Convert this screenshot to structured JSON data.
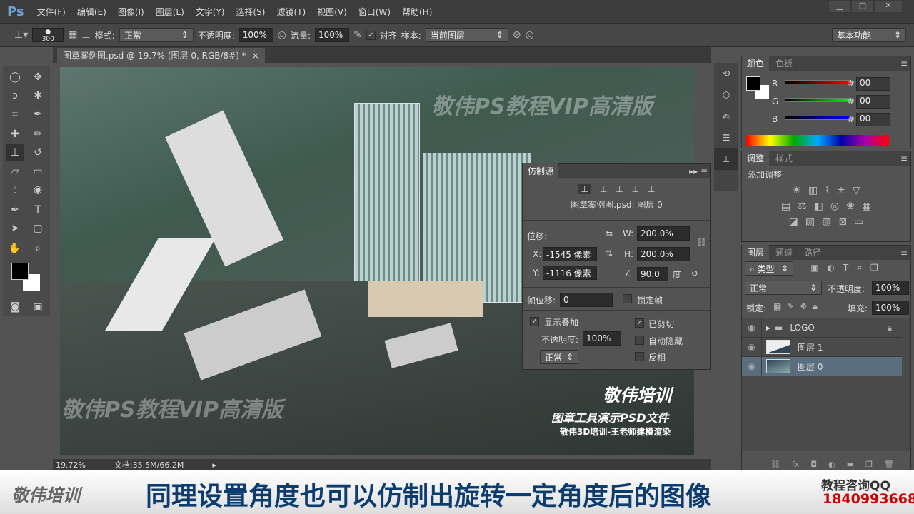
{
  "app": {
    "logo": "Ps",
    "menu": [
      "文件(F)",
      "编辑(E)",
      "图像(I)",
      "图层(L)",
      "文字(Y)",
      "选择(S)",
      "滤镜(T)",
      "视图(V)",
      "窗口(W)",
      "帮助(H)"
    ]
  },
  "options": {
    "brush_size": "300",
    "mode_label": "模式:",
    "mode": "正常",
    "opacity_label": "不透明度:",
    "opacity": "100%",
    "flow_label": "流量:",
    "flow": "100%",
    "align_label": "对齐",
    "sample_label": "样本:",
    "sample": "当前图层",
    "workspace": "基本功能"
  },
  "document": {
    "tab": "图章案例图.psd @ 19.7% (图层 0, RGB/8#) *",
    "zoom": "19.72%",
    "doc_size": "文档:35.5M/66.2M"
  },
  "canvas_text": {
    "watermark": "敬伟PS教程VIP高清版",
    "brand": "敬伟培训",
    "line1": "图章工具演示PSD文件",
    "line2": "敬伟3D培训-王老师建模渲染"
  },
  "clone_source": {
    "title": "仿制源",
    "source": "图章案例图.psd: 图层 0",
    "offset_label": "位移:",
    "x_label": "X:",
    "x": "-1545 像素",
    "y_label": "Y:",
    "y": "-1116 像素",
    "w_label": "W:",
    "w": "200.0%",
    "h_label": "H:",
    "h": "200.0%",
    "angle": "90.0",
    "angle_unit": "度",
    "frame_offset_label": "帧位移:",
    "frame_offset": "0",
    "lock_frame": "锁定帧",
    "show_overlay": "显示叠加",
    "overlay_opacity_label": "不透明度:",
    "overlay_opacity": "100%",
    "clipped": "已剪切",
    "auto_hide": "自动隐藏",
    "invert": "反相",
    "blend": "正常"
  },
  "color_panel": {
    "tabs": [
      "颜色",
      "色板"
    ],
    "r_label": "R",
    "g_label": "G",
    "b_label": "B",
    "hash": "#",
    "r": "00",
    "g": "00",
    "b": "00"
  },
  "adjust_panel": {
    "tabs": [
      "调整",
      "样式"
    ],
    "title": "添加调整"
  },
  "layers_panel": {
    "tabs": [
      "图层",
      "通道",
      "路径"
    ],
    "filter": "类型",
    "blend": "正常",
    "opacity_label": "不透明度:",
    "opacity": "100%",
    "lock_label": "锁定:",
    "fill_label": "填充:",
    "fill": "100%",
    "layers": [
      {
        "name": "LOGO"
      },
      {
        "name": "图层 1"
      },
      {
        "name": "图层 0"
      }
    ]
  },
  "banner": {
    "logo": "敬伟培训",
    "caption": "同理设置角度也可以仿制出旋转一定角度后的图像",
    "contact": "教程咨询QQ",
    "qq": "1840993668"
  }
}
